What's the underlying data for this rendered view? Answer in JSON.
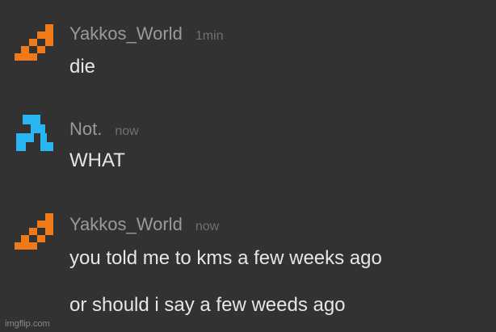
{
  "messages": [
    {
      "username": "Yakkos_World",
      "time": "1min",
      "avatar": "orange-pixel-icon",
      "lines": [
        "die"
      ]
    },
    {
      "username": "Not.",
      "time": "now",
      "avatar": "blue-pixel-icon",
      "lines": [
        "WHAT"
      ]
    },
    {
      "username": "Yakkos_World",
      "time": "now",
      "avatar": "orange-pixel-icon",
      "lines": [
        "you told me to kms a few weeks ago",
        "or should i say a few weeds ago"
      ]
    }
  ],
  "watermark": "imgflip.com",
  "colors": {
    "background": "#323232",
    "username": "#9a9a9a",
    "timestamp": "#707070",
    "message_text": "#e6e6e6",
    "orange_avatar": "#f07a1a",
    "blue_avatar": "#29b6f0"
  }
}
